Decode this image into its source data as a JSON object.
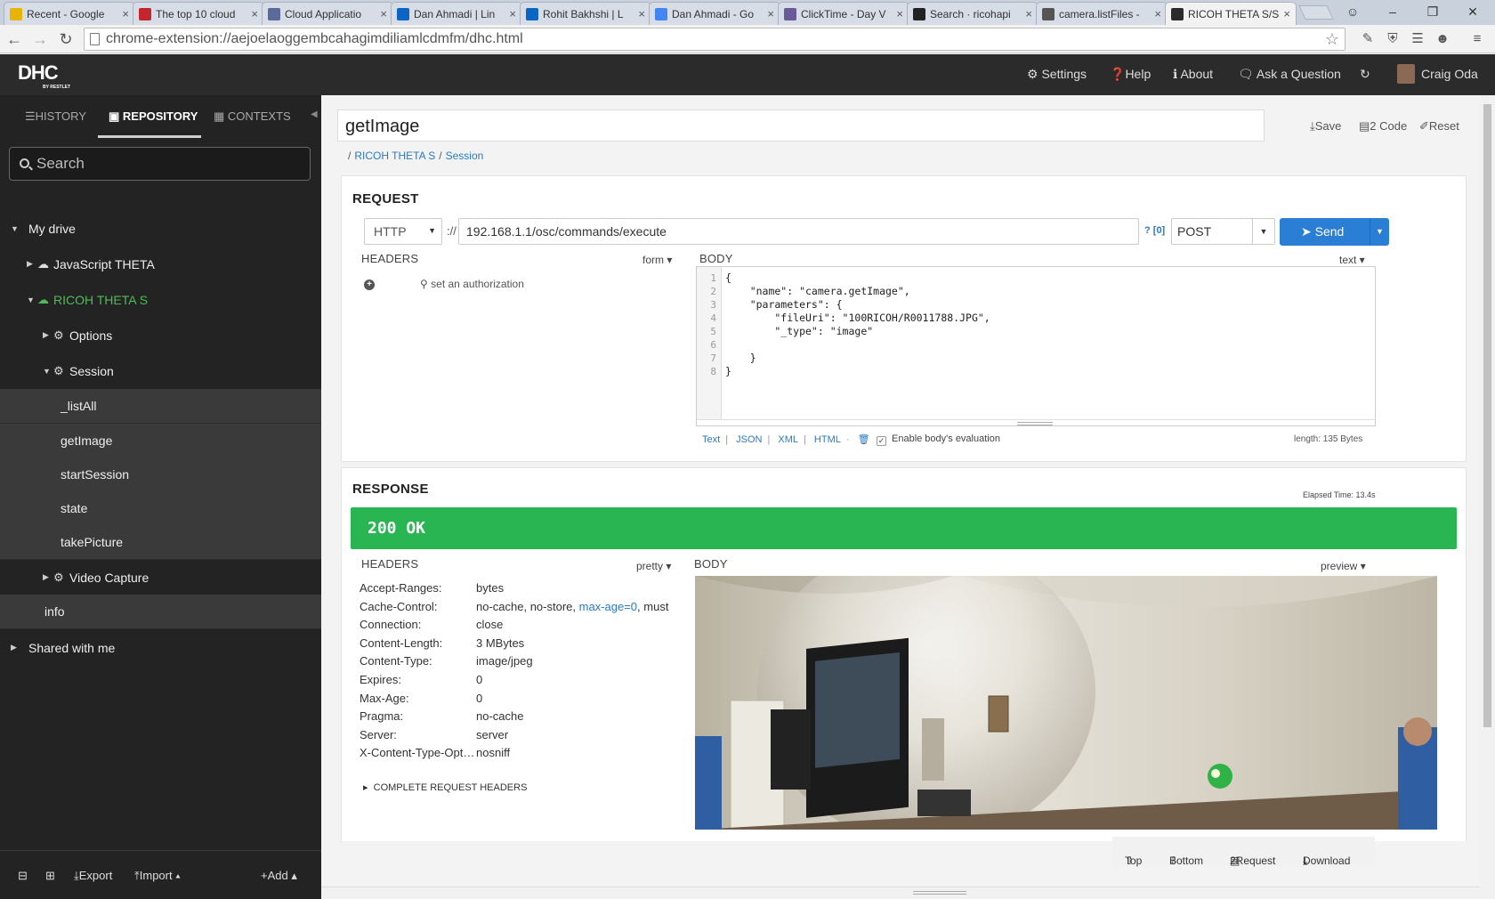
{
  "browser": {
    "tabs": [
      {
        "title": "Recent - Google",
        "favicon": "google-drive-icon",
        "color": "#e8b400"
      },
      {
        "title": "The top 10 cloud",
        "favicon": "vb-icon",
        "color": "#c3262d"
      },
      {
        "title": "Cloud Applicatio",
        "favicon": "cloud-app-icon",
        "color": "#5a6a9a"
      },
      {
        "title": "Dan Ahmadi | Lin",
        "favicon": "linkedin-icon",
        "color": "#0a66c2"
      },
      {
        "title": "Rohit Bakhshi | L",
        "favicon": "linkedin-icon",
        "color": "#0a66c2"
      },
      {
        "title": "Dan Ahmadi - Go",
        "favicon": "google-icon",
        "color": "#4285f4"
      },
      {
        "title": "ClickTime - Day V",
        "favicon": "clicktime-icon",
        "color": "#6a5a9a"
      },
      {
        "title": "Search · ricohapi",
        "favicon": "github-icon",
        "color": "#222222"
      },
      {
        "title": "camera.listFiles -",
        "favicon": "globe-icon",
        "color": "#555555"
      },
      {
        "title": "RICOH THETA S/S",
        "favicon": "dhc-icon",
        "color": "#2b2b2b"
      }
    ],
    "url": "chrome-extension://aejoelaoggembcahagimdiliamlcdmfm/dhc.html"
  },
  "app": {
    "logo_text": "DHC",
    "logo_sub": "BY RESTLET",
    "nav": {
      "settings": "Settings",
      "help": "Help",
      "about": "About",
      "ask": "Ask a Question",
      "user": "Craig Oda"
    }
  },
  "sidebar": {
    "tabs": {
      "history": "HISTORY",
      "repository": "REPOSITORY",
      "contexts": "CONTEXTS"
    },
    "search_placeholder": "Search",
    "tree": {
      "my_drive": "My drive",
      "javascript_theta": "JavaScript THETA",
      "ricoh_theta_s": "RICOH THETA S",
      "options": "Options",
      "session": "Session",
      "listall": "_listAll",
      "getimage": "getImage",
      "startsession": "startSession",
      "state": "state",
      "takepicture": "takePicture",
      "video_capture": "Video Capture",
      "info": "info",
      "shared": "Shared with me"
    },
    "footer": {
      "export": "Export",
      "import": "Import",
      "add": "Add"
    }
  },
  "request": {
    "name": "getImage",
    "actions": {
      "save": "Save",
      "code": "2 Code",
      "reset": "Reset"
    },
    "breadcrumb": [
      "RICOH THETA S",
      "Session"
    ],
    "title": "REQUEST",
    "scheme": "HTTP",
    "scheme_sep": "://",
    "url": "192.168.1.1/osc/commands/execute",
    "url_params": "? [0]",
    "method": "POST",
    "send": "Send",
    "headers_label": "HEADERS",
    "headers_mode": "form",
    "auth_link": "set an authorization",
    "body_label": "BODY",
    "body_mode": "text",
    "body_lines": [
      "{",
      "    \"name\": \"camera.getImage\",",
      "    \"parameters\": {",
      "        \"fileUri\": \"100RICOH/R0011788.JPG\",",
      "        \"_type\": \"image\"",
      "",
      "    }",
      "}"
    ],
    "line_numbers": "1\n2\n3\n4\n5\n6\n7\n8",
    "formats": {
      "text": "Text",
      "json": "JSON",
      "xml": "XML",
      "html": "HTML"
    },
    "eval_label": "Enable body's evaluation",
    "eval_checked": true,
    "length": "length: 135 Bytes"
  },
  "response": {
    "title": "RESPONSE",
    "elapsed": "Elapsed Time: 13.4s",
    "status": "200 OK",
    "status_color": "#2ab553",
    "headers_label": "HEADERS",
    "headers_mode": "pretty",
    "body_label": "BODY",
    "body_mode": "preview",
    "headers": [
      {
        "key": "Accept-Ranges:",
        "value": "bytes"
      },
      {
        "key": "Cache-Control:",
        "value": "no-cache, no-store, ",
        "link": "max-age=0",
        "tail": ", must"
      },
      {
        "key": "Connection:",
        "value": "close"
      },
      {
        "key": "Content-Length:",
        "value": "3 MBytes"
      },
      {
        "key": "Content-Type:",
        "value": "image/jpeg"
      },
      {
        "key": "Expires:",
        "value": "0"
      },
      {
        "key": "Max-Age:",
        "value": "0"
      },
      {
        "key": "Pragma:",
        "value": "no-cache"
      },
      {
        "key": "Server:",
        "value": "server"
      },
      {
        "key": "X-Content-Type-Optio...",
        "value": "nosniff"
      }
    ],
    "complete_headers": "COMPLETE REQUEST HEADERS",
    "preview_actions": {
      "top": "Top",
      "bottom": "Bottom",
      "to_request": "2Request",
      "download": "Download"
    }
  }
}
